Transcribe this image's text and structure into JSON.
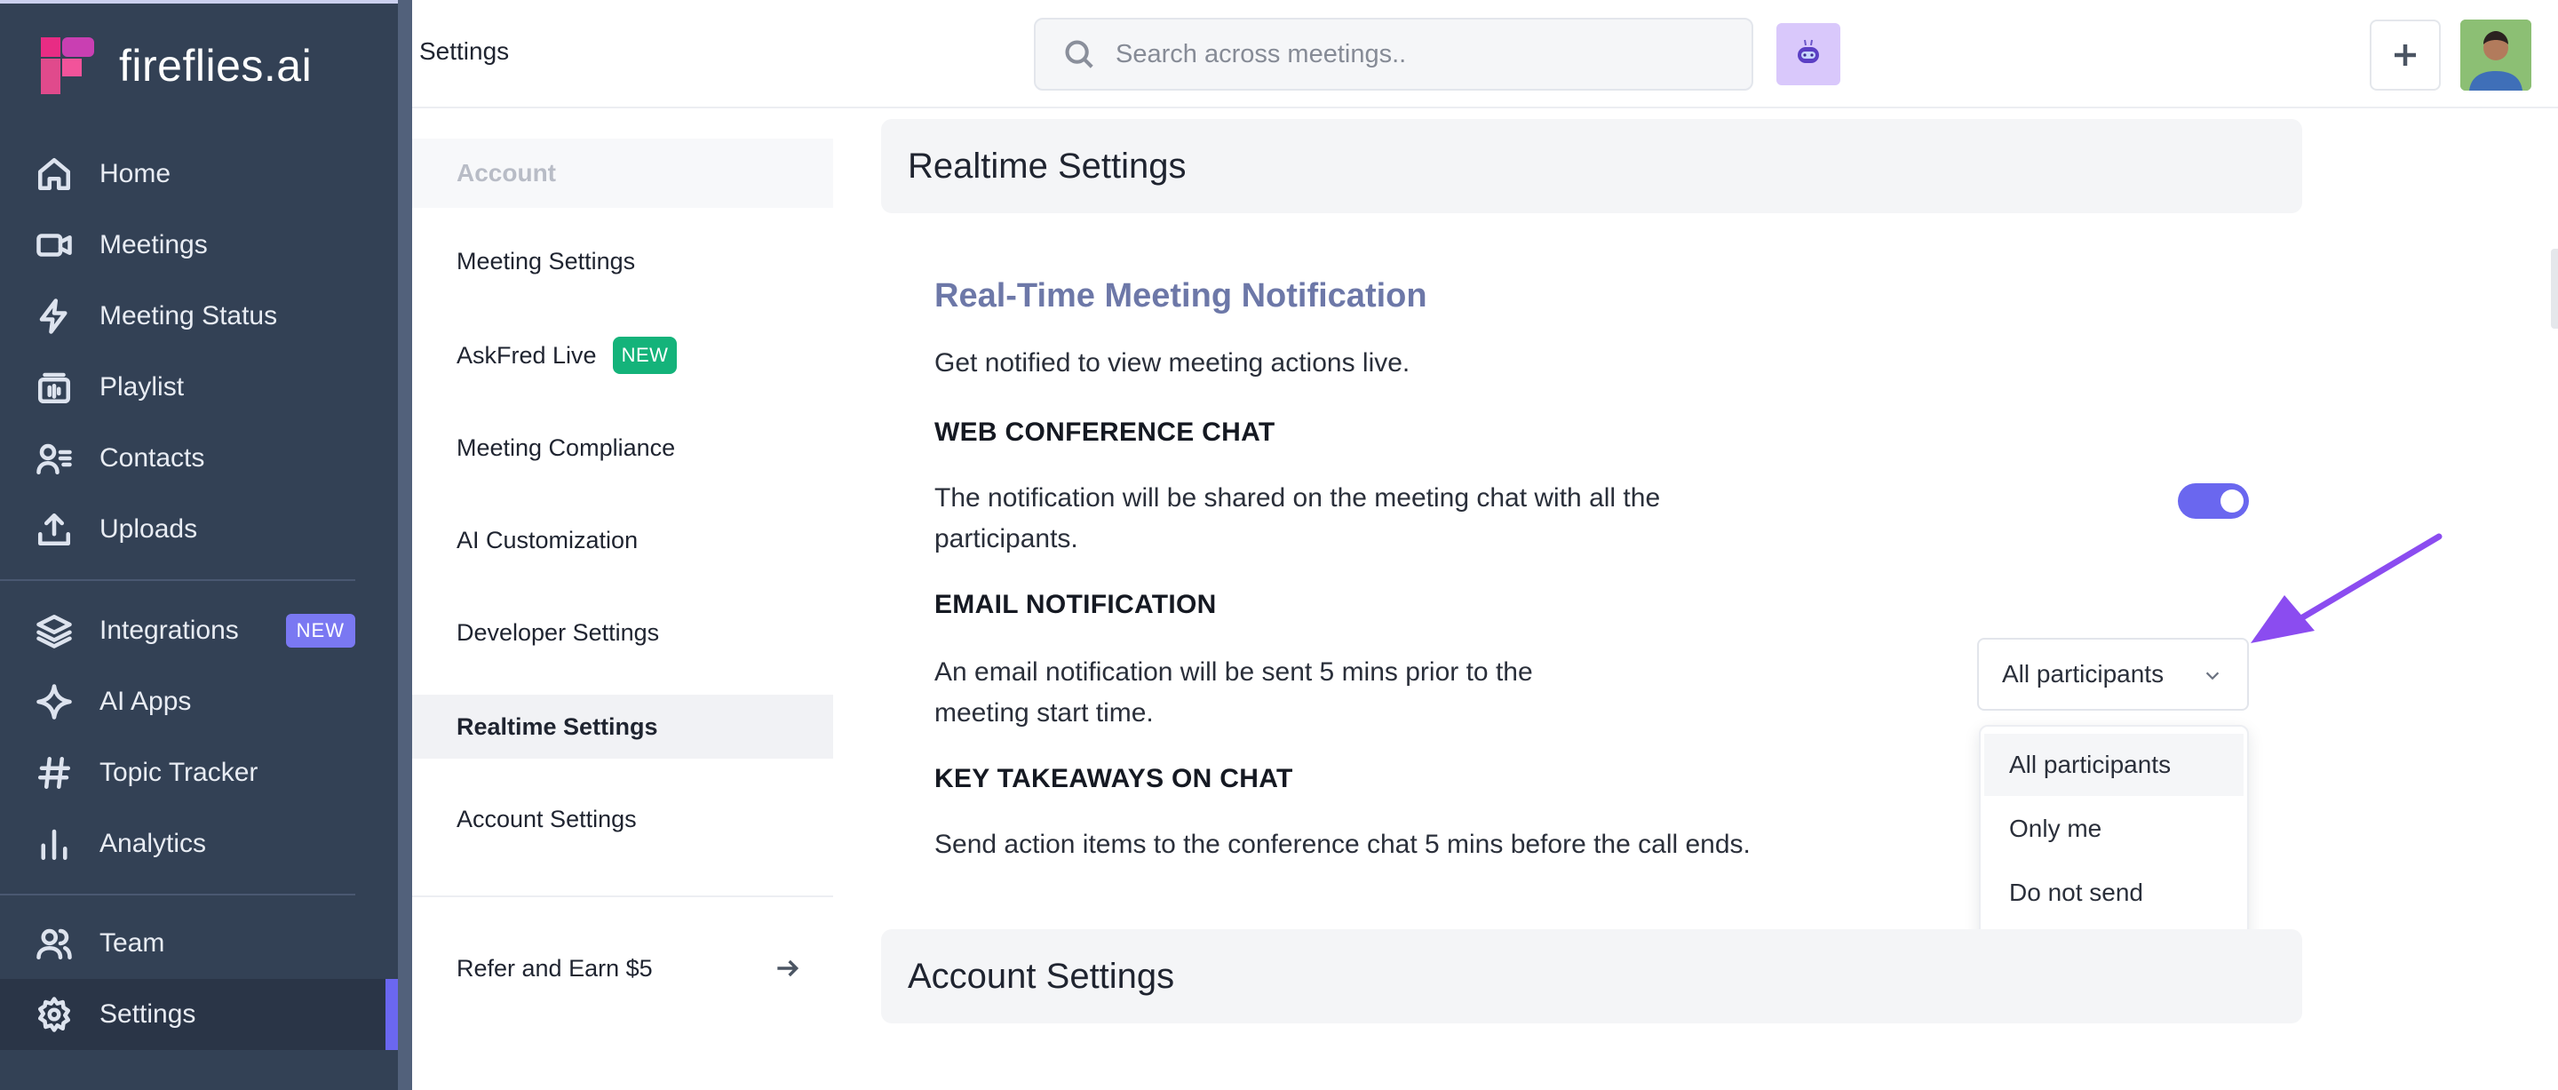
{
  "brand": {
    "name": "fireflies.ai"
  },
  "nav": {
    "items": [
      {
        "label": "Home",
        "icon": "home-icon"
      },
      {
        "label": "Meetings",
        "icon": "video-icon"
      },
      {
        "label": "Meeting Status",
        "icon": "lightning-icon"
      },
      {
        "label": "Playlist",
        "icon": "playlist-icon"
      },
      {
        "label": "Contacts",
        "icon": "contacts-icon"
      },
      {
        "label": "Uploads",
        "icon": "upload-icon"
      },
      {
        "label": "Integrations",
        "icon": "layers-icon",
        "badge": "NEW"
      },
      {
        "label": "AI Apps",
        "icon": "sparkle-icon"
      },
      {
        "label": "Topic Tracker",
        "icon": "hashtag-icon"
      },
      {
        "label": "Analytics",
        "icon": "bar-chart-icon"
      },
      {
        "label": "Team",
        "icon": "team-icon"
      },
      {
        "label": "Settings",
        "icon": "gear-icon",
        "active": true
      }
    ]
  },
  "header": {
    "title": "Settings",
    "search_placeholder": "Search across meetings.."
  },
  "settings_menu": {
    "section": "Account",
    "items": [
      {
        "label": "Meeting Settings"
      },
      {
        "label": "AskFred Live",
        "badge": "NEW"
      },
      {
        "label": "Meeting Compliance"
      },
      {
        "label": "AI Customization"
      },
      {
        "label": "Developer Settings"
      },
      {
        "label": "Realtime Settings",
        "active": true
      },
      {
        "label": "Account Settings"
      }
    ],
    "refer": "Refer and Earn $5"
  },
  "main": {
    "realtime_header": "Realtime Settings",
    "notification_title": "Real-Time Meeting Notification",
    "notification_subtitle": "Get notified to view meeting actions live.",
    "web_chat": {
      "label": "WEB CONFERENCE CHAT",
      "desc_line1": "The notification will be shared on the meeting chat with all the",
      "desc_line2": "participants.",
      "enabled": true
    },
    "email": {
      "label": "EMAIL NOTIFICATION",
      "desc_line1": "An email notification will be sent 5 mins prior to the",
      "desc_line2": "meeting start time.",
      "selected": "All participants",
      "options": [
        "All participants",
        "Only me",
        "Do not send"
      ]
    },
    "takeaways": {
      "label": "KEY TAKEAWAYS ON CHAT",
      "desc": "Send action items to the conference chat 5 mins before the call ends."
    },
    "account_header": "Account Settings"
  },
  "colors": {
    "sidebar_bg": "#334155",
    "accent": "#6b67f0",
    "new_badge_green": "#14b37a",
    "title_blue": "#6d78a8",
    "annotation_arrow": "#8b4cf0"
  }
}
